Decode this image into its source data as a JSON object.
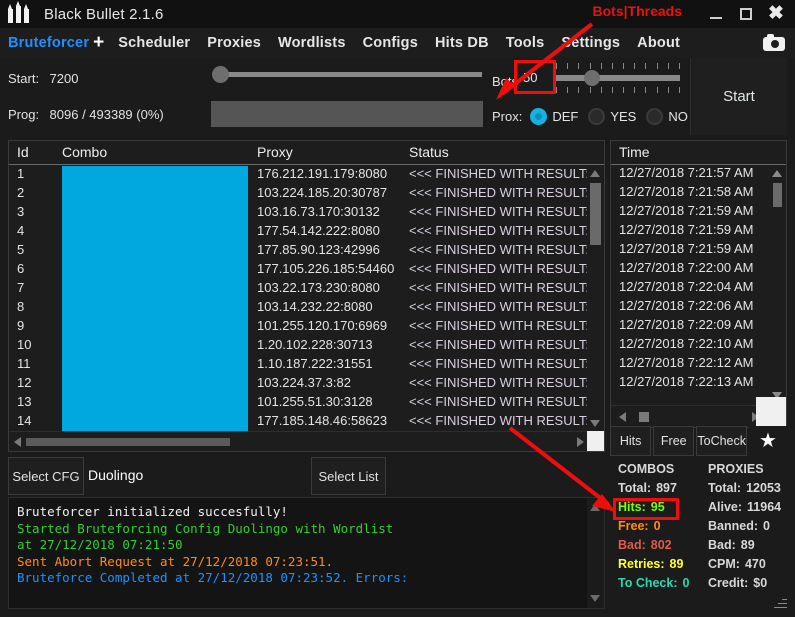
{
  "window": {
    "title": "Black Bullet 2.1.6",
    "logo_icon": "bullets-logo-icon",
    "minimize_icon": "minimize-icon",
    "maximize_icon": "maximize-icon",
    "close_icon": "close-icon"
  },
  "annotations": {
    "bots_threads_label": "Bots|Threads",
    "annotation_color": "#e81212"
  },
  "menu": {
    "items": [
      {
        "label": "Bruteforcer",
        "active": true
      },
      {
        "label": "Scheduler",
        "active": false
      },
      {
        "label": "Proxies",
        "active": false
      },
      {
        "label": "Wordlists",
        "active": false
      },
      {
        "label": "Configs",
        "active": false
      },
      {
        "label": "Hits DB",
        "active": false
      },
      {
        "label": "Tools",
        "active": false
      },
      {
        "label": "Settings",
        "active": false
      },
      {
        "label": "About",
        "active": false
      }
    ],
    "add_tab_label": "+",
    "camera_icon": "camera-icon"
  },
  "controls": {
    "start_label": "Start:",
    "start_value": "7200",
    "prog_label": "Prog:",
    "prog_value": "8096 / 493389 (0%)",
    "bots_label": "Bots:",
    "bots_value": "50",
    "prox_label": "Prox:",
    "prox_options": [
      {
        "label": "DEF",
        "selected": true
      },
      {
        "label": "YES",
        "selected": false
      },
      {
        "label": "NO",
        "selected": false
      }
    ],
    "start_button": "Start"
  },
  "grid": {
    "columns": [
      "Id",
      "Combo",
      "Proxy",
      "Status"
    ],
    "rows": [
      {
        "id": "1",
        "combo": "",
        "proxy": "176.212.191.179:8080",
        "status": "<<< FINISHED WITH RESULT: EI"
      },
      {
        "id": "2",
        "combo": "",
        "proxy": "103.224.185.20:30787",
        "status": "<<< FINISHED WITH RESULT: EI"
      },
      {
        "id": "3",
        "combo": "",
        "proxy": "103.16.73.170:30132",
        "status": "<<< FINISHED WITH RESULT: EI"
      },
      {
        "id": "4",
        "combo": "",
        "proxy": "177.54.142.222:8080",
        "status": "<<< FINISHED WITH RESULT: EI"
      },
      {
        "id": "5",
        "combo": "",
        "proxy": "177.85.90.123:42996",
        "status": "<<< FINISHED WITH RESULT: EI"
      },
      {
        "id": "6",
        "combo": "",
        "proxy": "177.105.226.185:54460",
        "status": "<<< FINISHED WITH RESULT: EI"
      },
      {
        "id": "7",
        "combo": "",
        "proxy": "103.22.173.230:8080",
        "status": "<<< FINISHED WITH RESULT: EI"
      },
      {
        "id": "8",
        "combo": "",
        "proxy": "103.14.232.22:8080",
        "status": "<<< FINISHED WITH RESULT: EI"
      },
      {
        "id": "9",
        "combo": "",
        "proxy": "101.255.120.170:6969",
        "status": "<<< FINISHED WITH RESULT: EI"
      },
      {
        "id": "10",
        "combo": "",
        "proxy": "1.20.102.228:30713",
        "status": "<<< FINISHED WITH RESULT: EI"
      },
      {
        "id": "11",
        "combo": "",
        "proxy": "1.10.187.222:31551",
        "status": "<<< FINISHED WITH RESULT: EI"
      },
      {
        "id": "12",
        "combo": "",
        "proxy": "103.224.37.3:82",
        "status": "<<< FINISHED WITH RESULT: EI"
      },
      {
        "id": "13",
        "combo": "",
        "proxy": "101.255.51.30:3128",
        "status": "<<< FINISHED WITH RESULT: EI"
      },
      {
        "id": "14",
        "combo": "",
        "proxy": "177.185.148.46:58623",
        "status": "<<< FINISHED WITH RESULT: EI"
      }
    ],
    "combo_masked": true,
    "combo_mask_color": "#00a8e0"
  },
  "time_panel": {
    "header": "Time",
    "rows": [
      "12/27/2018 7:21:57 AM",
      "12/27/2018 7:21:58 AM",
      "12/27/2018 7:21:59 AM",
      "12/27/2018 7:21:59 AM",
      "12/27/2018 7:21:59 AM",
      "12/27/2018 7:22:00 AM",
      "12/27/2018 7:22:04 AM",
      "12/27/2018 7:22:06 AM",
      "12/27/2018 7:22:09 AM",
      "12/27/2018 7:22:10 AM",
      "12/27/2018 7:22:12 AM",
      "12/27/2018 7:22:13 AM"
    ]
  },
  "tabs": {
    "items": [
      "Hits",
      "Free",
      "ToCheck"
    ],
    "star_icon": "star-icon"
  },
  "config_row": {
    "select_cfg_button": "Select CFG",
    "config_name": "Duolingo",
    "select_list_button": "Select List"
  },
  "log": {
    "lines": [
      {
        "text": "Bruteforcer initialized succesfully!",
        "color": "#f0f0f0"
      },
      {
        "text": "Started Bruteforcing Config Duolingo with Wordlist",
        "color": "#33cc33"
      },
      {
        "text": "at 27/12/2018 07:21:50",
        "color": "#33cc33"
      },
      {
        "text": "Sent Abort Request at 27/12/2018 07:23:51.",
        "color": "#ff8c1a"
      },
      {
        "text": "Bruteforce Completed at 27/12/2018 07:23:52. Errors:",
        "color": "#1e90ff"
      }
    ]
  },
  "stats": {
    "combos": {
      "title": "COMBOS",
      "rows": [
        {
          "key": "Total:",
          "value": "897",
          "color": "#d8d8d8"
        },
        {
          "key": "Hits:",
          "value": "95",
          "color": "#7cfc00"
        },
        {
          "key": "Free:",
          "value": "0",
          "color": "#ff8c1a"
        },
        {
          "key": "Bad:",
          "value": "802",
          "color": "#e05b4b"
        },
        {
          "key": "Retries:",
          "value": "89",
          "color": "#ffff33"
        },
        {
          "key": "To Check:",
          "value": "0",
          "color": "#2bd9b0"
        }
      ]
    },
    "proxies": {
      "title": "PROXIES",
      "rows": [
        {
          "key": "Total:",
          "value": "12053",
          "color": "#d8d8d8"
        },
        {
          "key": "Alive:",
          "value": "11964",
          "color": "#d8d8d8"
        },
        {
          "key": "Banned:",
          "value": "0",
          "color": "#d8d8d8"
        },
        {
          "key": "Bad:",
          "value": "89",
          "color": "#d8d8d8"
        },
        {
          "key": "CPM:",
          "value": "470",
          "color": "#d8d8d8"
        },
        {
          "key": "Credit:",
          "value": "$0",
          "color": "#d8d8d8"
        }
      ]
    }
  }
}
